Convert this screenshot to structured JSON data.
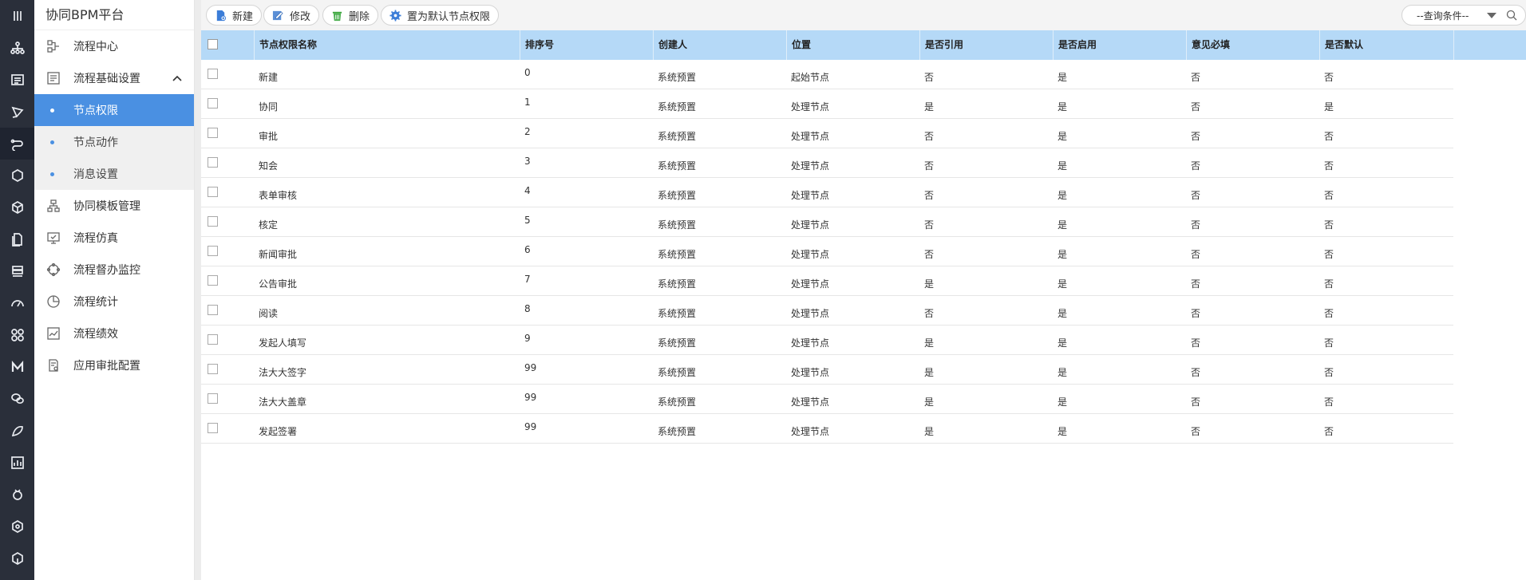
{
  "sidebar": {
    "title": "协同BPM平台",
    "items": [
      {
        "label": "流程中心",
        "icon": "flow-center-icon"
      },
      {
        "label": "流程基础设置",
        "icon": "settings-form-icon"
      },
      {
        "label": "协同模板管理",
        "icon": "template-icon"
      },
      {
        "label": "流程仿真",
        "icon": "monitor-icon"
      },
      {
        "label": "流程督办监控",
        "icon": "supervise-icon"
      },
      {
        "label": "流程统计",
        "icon": "pie-chart-icon"
      },
      {
        "label": "流程绩效",
        "icon": "performance-icon"
      },
      {
        "label": "应用审批配置",
        "icon": "approval-config-icon"
      }
    ],
    "subitems": [
      {
        "label": "节点权限"
      },
      {
        "label": "节点动作"
      },
      {
        "label": "消息设置"
      }
    ]
  },
  "toolbar": {
    "new_label": "新建",
    "edit_label": "修改",
    "delete_label": "删除",
    "set_default_label": "置为默认节点权限",
    "query_label": "--查询条件--"
  },
  "table": {
    "headers": [
      "节点权限名称",
      "排序号",
      "创建人",
      "位置",
      "是否引用",
      "是否启用",
      "意见必填",
      "是否默认"
    ],
    "rows": [
      [
        "新建",
        "0",
        "系统预置",
        "起始节点",
        "否",
        "是",
        "否",
        "否"
      ],
      [
        "协同",
        "1",
        "系统预置",
        "处理节点",
        "是",
        "是",
        "否",
        "是"
      ],
      [
        "审批",
        "2",
        "系统预置",
        "处理节点",
        "否",
        "是",
        "否",
        "否"
      ],
      [
        "知会",
        "3",
        "系统预置",
        "处理节点",
        "否",
        "是",
        "否",
        "否"
      ],
      [
        "表单审核",
        "4",
        "系统预置",
        "处理节点",
        "否",
        "是",
        "否",
        "否"
      ],
      [
        "核定",
        "5",
        "系统预置",
        "处理节点",
        "否",
        "是",
        "否",
        "否"
      ],
      [
        "新闻审批",
        "6",
        "系统预置",
        "处理节点",
        "否",
        "是",
        "否",
        "否"
      ],
      [
        "公告审批",
        "7",
        "系统预置",
        "处理节点",
        "是",
        "是",
        "否",
        "否"
      ],
      [
        "阅读",
        "8",
        "系统预置",
        "处理节点",
        "否",
        "是",
        "否",
        "否"
      ],
      [
        "发起人填写",
        "9",
        "系统预置",
        "处理节点",
        "是",
        "是",
        "否",
        "否"
      ],
      [
        "法大大签字",
        "99",
        "系统预置",
        "处理节点",
        "是",
        "是",
        "否",
        "否"
      ],
      [
        "法大大盖章",
        "99",
        "系统预置",
        "处理节点",
        "是",
        "是",
        "否",
        "否"
      ],
      [
        "发起签署",
        "99",
        "系统预置",
        "处理节点",
        "是",
        "是",
        "否",
        "否"
      ]
    ]
  },
  "colors": {
    "accent": "#4a90e2",
    "header_bg": "#b5d9f7",
    "rail_bg": "#2a2f3a"
  }
}
